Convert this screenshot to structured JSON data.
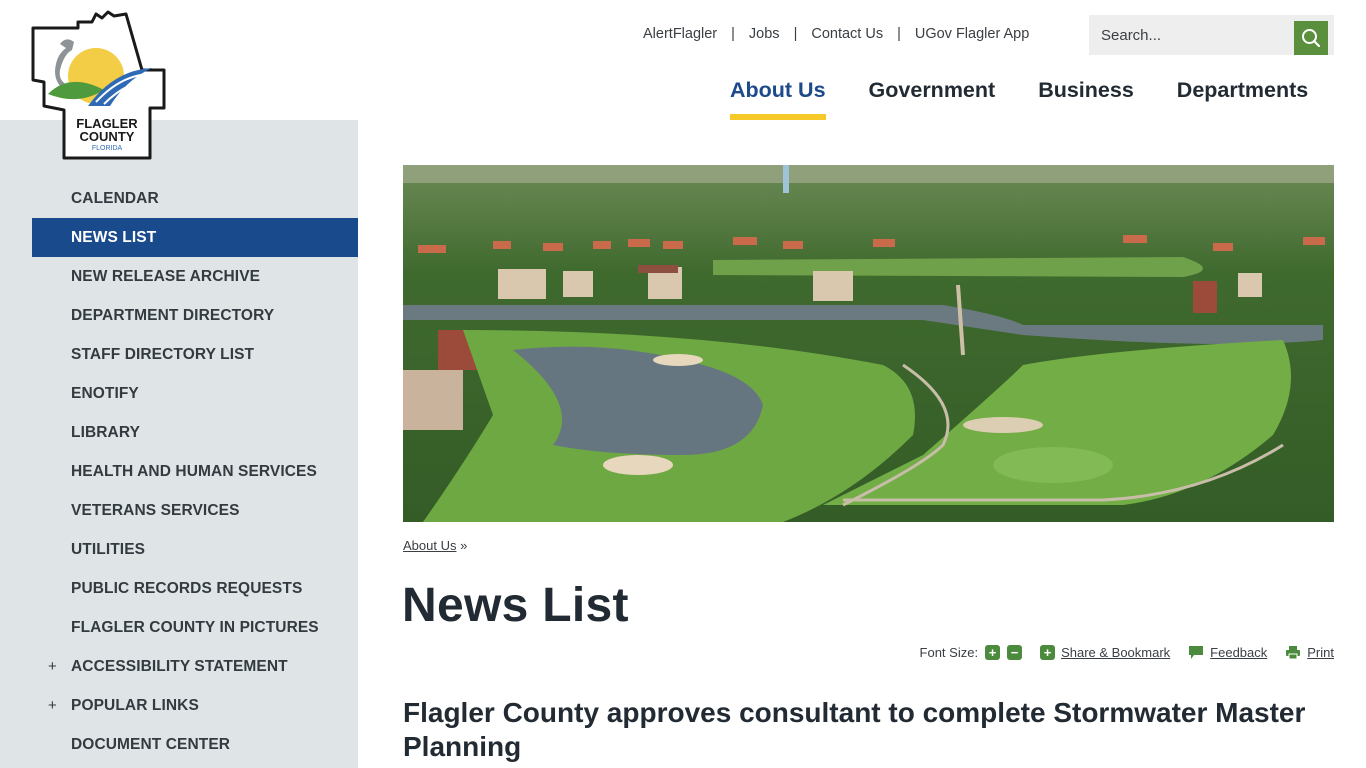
{
  "logo": {
    "line1": "FLAGLER",
    "line2": "COUNTY",
    "line3": "FLORIDA"
  },
  "utility_links": [
    "AlertFlagler",
    "Jobs",
    "Contact Us",
    "UGov Flagler App"
  ],
  "utility_separator": "|",
  "search": {
    "placeholder": "Search...",
    "button_icon": "search-icon"
  },
  "main_nav": [
    {
      "label": "About Us",
      "active": true
    },
    {
      "label": "Government",
      "active": false
    },
    {
      "label": "Business",
      "active": false
    },
    {
      "label": "Departments",
      "active": false
    }
  ],
  "sidebar": {
    "items": [
      {
        "label": "CALENDAR",
        "expandable": false,
        "active": false
      },
      {
        "label": "NEWS LIST",
        "expandable": false,
        "active": true
      },
      {
        "label": "NEW RELEASE ARCHIVE",
        "expandable": false,
        "active": false
      },
      {
        "label": "DEPARTMENT DIRECTORY",
        "expandable": false,
        "active": false
      },
      {
        "label": "STAFF DIRECTORY LIST",
        "expandable": false,
        "active": false
      },
      {
        "label": "ENOTIFY",
        "expandable": false,
        "active": false
      },
      {
        "label": "LIBRARY",
        "expandable": false,
        "active": false
      },
      {
        "label": "HEALTH AND HUMAN SERVICES",
        "expandable": false,
        "active": false
      },
      {
        "label": "VETERANS SERVICES",
        "expandable": false,
        "active": false
      },
      {
        "label": "UTILITIES",
        "expandable": false,
        "active": false
      },
      {
        "label": "PUBLIC RECORDS REQUESTS",
        "expandable": false,
        "active": false
      },
      {
        "label": "FLAGLER COUNTY IN PICTURES",
        "expandable": false,
        "active": false
      },
      {
        "label": "ACCESSIBILITY STATEMENT",
        "expandable": true,
        "active": false
      },
      {
        "label": "POPULAR LINKS",
        "expandable": true,
        "active": false
      },
      {
        "label": "DOCUMENT CENTER",
        "expandable": false,
        "active": false
      }
    ],
    "expand_symbol": "+"
  },
  "hero": {
    "description": "Aerial view of golf course with ponds and homes"
  },
  "breadcrumb": {
    "link": "About Us",
    "separator": "»"
  },
  "page_title": "News List",
  "tools": {
    "font_size_label": "Font Size:",
    "increase": "+",
    "decrease": "−",
    "share_label": "Share & Bookmark",
    "feedback_label": "Feedback",
    "print_label": "Print"
  },
  "article": {
    "title": "Flagler County approves consultant to complete Stormwater Master Planning"
  },
  "colors": {
    "nav_active": "#1d4a8a",
    "sidebar_active_bg": "#184a8c",
    "underline_accent": "#f7c928",
    "action_green": "#5a8f3e",
    "sidebar_bg": "#dfe5e6"
  }
}
